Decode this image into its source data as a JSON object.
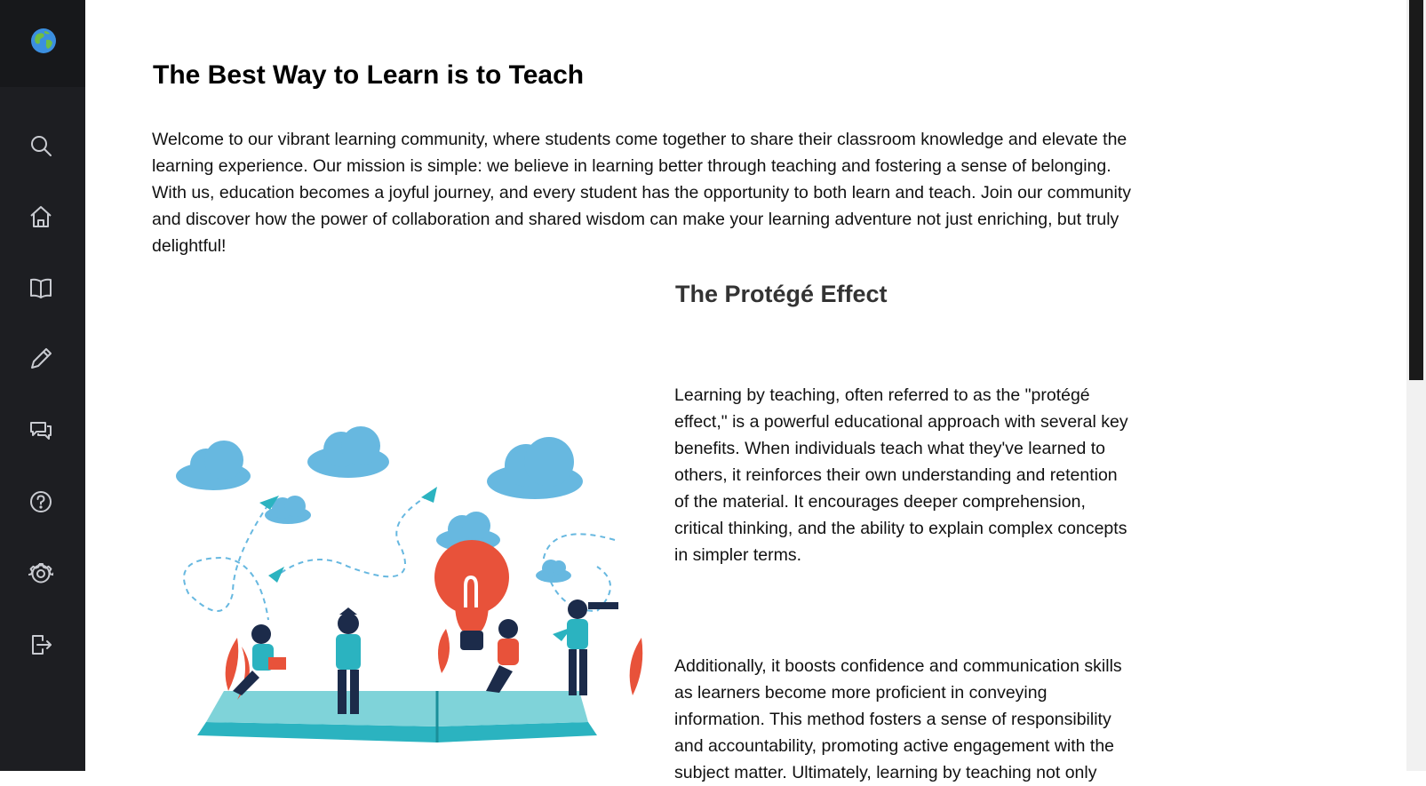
{
  "sidebar": {
    "logo_icon": "globe-icon",
    "items": [
      {
        "name": "search",
        "icon": "search-icon"
      },
      {
        "name": "home",
        "icon": "home-icon"
      },
      {
        "name": "courses",
        "icon": "book-icon"
      },
      {
        "name": "write",
        "icon": "pencil-icon"
      },
      {
        "name": "chat",
        "icon": "chat-icon"
      },
      {
        "name": "help",
        "icon": "help-icon"
      },
      {
        "name": "settings",
        "icon": "gear-icon"
      },
      {
        "name": "logout",
        "icon": "logout-icon"
      }
    ],
    "background": "#1d1e22",
    "icon_color": "#c9cbd1"
  },
  "main": {
    "title": "The Best Way to Learn is to Teach",
    "intro": "Welcome to our vibrant learning community, where students come together to share their classroom knowledge and elevate the learning experience. Our mission is simple: we believe in learning better through teaching and fostering a sense of belonging. With us, education becomes a joyful journey, and every student has the opportunity to both learn and teach. Join our community and discover how the power of collaboration and shared wisdom can make your learning adventure not just enriching, but truly delightful!",
    "section": {
      "title": "The Protégé Effect",
      "paragraphs": [
        "Learning by teaching, often referred to as the \"protégé effect,\" is a powerful educational approach with several key benefits. When individuals teach what they've learned to others, it reinforces their own understanding and retention of the material. It encourages deeper comprehension, critical thinking, and the ability to explain complex concepts in simpler terms.",
        "Additionally, it boosts confidence and communication skills as learners become more proficient in conveying information. This method fosters a sense of responsibility and accountability, promoting active engagement with the subject matter. Ultimately, learning by teaching not only"
      ]
    },
    "illustration_icon": "teaching-illustration"
  },
  "colors": {
    "cloud": "#67b8e0",
    "bulb": "#e8523a",
    "teal": "#2bb3c0",
    "navy": "#1c2b4a"
  }
}
